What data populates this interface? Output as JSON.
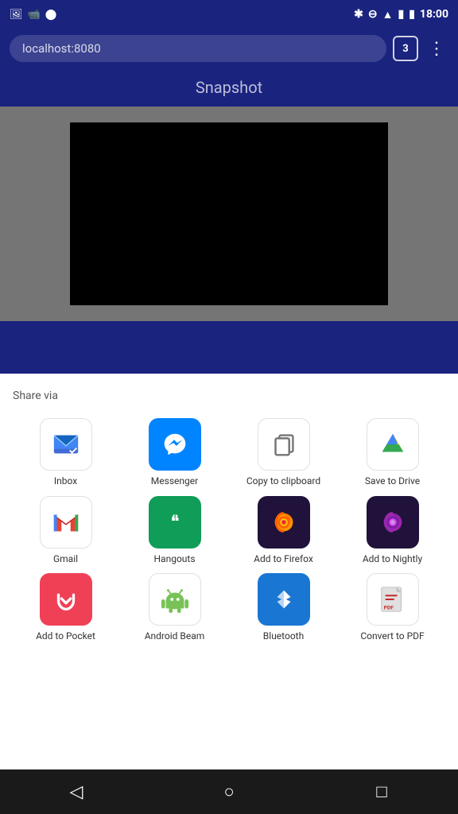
{
  "status_bar": {
    "time": "18:00",
    "icons_left": [
      "photo",
      "video",
      "circle"
    ],
    "icons_right": [
      "bluetooth",
      "no-disturb",
      "wifi",
      "signal",
      "battery"
    ]
  },
  "browser": {
    "url": "localhost:8080",
    "tab_count": "3",
    "menu_label": "⋮"
  },
  "page": {
    "title": "Snapshot"
  },
  "share_sheet": {
    "label": "Share via",
    "items": [
      {
        "id": "inbox",
        "label": "Inbox",
        "icon_class": "icon-inbox"
      },
      {
        "id": "messenger",
        "label": "Messenger",
        "icon_class": "icon-messenger"
      },
      {
        "id": "clipboard",
        "label": "Copy to clipboard",
        "icon_class": "icon-clipboard"
      },
      {
        "id": "drive",
        "label": "Save to Drive",
        "icon_class": "icon-drive"
      },
      {
        "id": "gmail",
        "label": "Gmail",
        "icon_class": "icon-gmail"
      },
      {
        "id": "hangouts",
        "label": "Hangouts",
        "icon_class": "icon-hangouts"
      },
      {
        "id": "firefox",
        "label": "Add to Firefox",
        "icon_class": "icon-firefox"
      },
      {
        "id": "nightly",
        "label": "Add to Nightly",
        "icon_class": "icon-nightly"
      },
      {
        "id": "pocket",
        "label": "Add to Pocket",
        "icon_class": "icon-pocket"
      },
      {
        "id": "android",
        "label": "Android Beam",
        "icon_class": "icon-android"
      },
      {
        "id": "bluetooth",
        "label": "Bluetooth",
        "icon_class": "icon-bluetooth"
      },
      {
        "id": "convert",
        "label": "Convert to PDF",
        "icon_class": "icon-convert"
      }
    ]
  },
  "nav_bar": {
    "back_label": "◁",
    "home_label": "○",
    "recent_label": "□"
  }
}
